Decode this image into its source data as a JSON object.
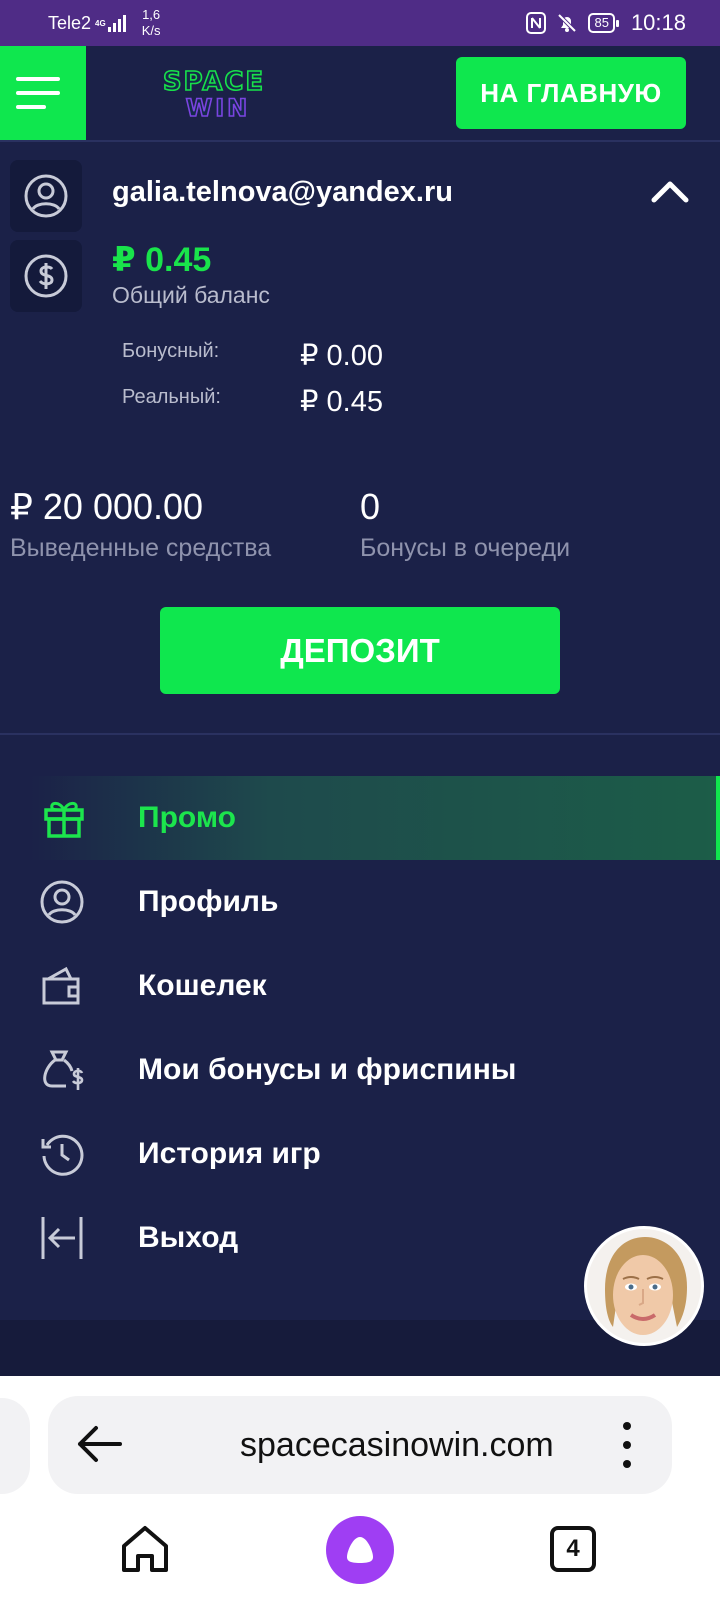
{
  "status_bar": {
    "carrier": "Tele2",
    "network": "4G",
    "speed_value": "1,6",
    "speed_unit": "K/s",
    "battery": "85",
    "time": "10:18"
  },
  "header": {
    "logo_line1": "SPACE",
    "logo_line2": "WIN",
    "home_button": "НА ГЛАВНУЮ"
  },
  "account": {
    "email": "galia.telnova@yandex.ru",
    "total_balance": "₽ 0.45",
    "total_balance_label": "Общий баланс",
    "bonus_label": "Бонусный:",
    "bonus_value": "₽ 0.00",
    "real_label": "Реальный:",
    "real_value": "₽ 0.45"
  },
  "stats": {
    "withdrawn_value": "₽ 20 000.00",
    "withdrawn_label": "Выведенные средства",
    "queued_value": "0",
    "queued_label": "Бонусы в очереди"
  },
  "deposit_button": "ДЕПОЗИТ",
  "menu": {
    "items": [
      {
        "label": "Промо",
        "icon": "gift-icon",
        "active": true
      },
      {
        "label": "Профиль",
        "icon": "user-icon",
        "active": false
      },
      {
        "label": "Кошелек",
        "icon": "wallet-icon",
        "active": false
      },
      {
        "label": "Мои бонусы и фриспины",
        "icon": "money-bag-icon",
        "active": false
      },
      {
        "label": "История игр",
        "icon": "history-icon",
        "active": false
      },
      {
        "label": "Выход",
        "icon": "logout-icon",
        "active": false
      }
    ]
  },
  "browser": {
    "url": "spacecasinowin.com",
    "tab_count": "4"
  },
  "colors": {
    "accent_green": "#0fe74e",
    "background": "#1b2148",
    "status_bar": "#4f2c86"
  }
}
